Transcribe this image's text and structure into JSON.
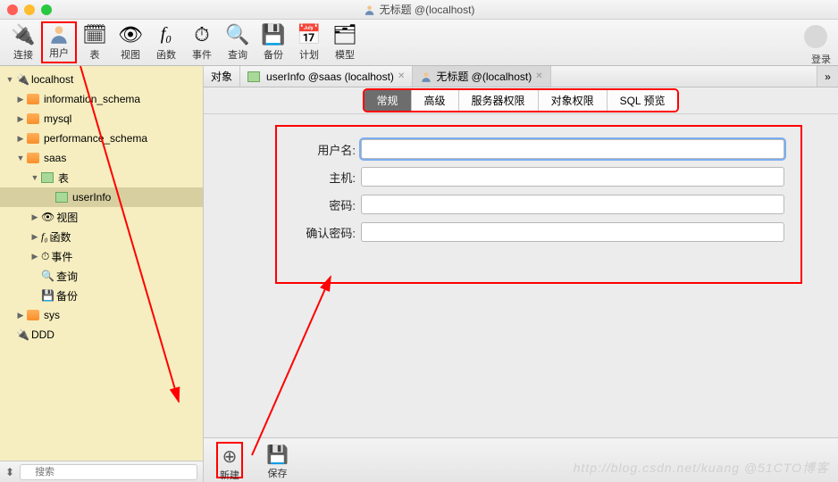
{
  "window": {
    "title": "无标题 @(localhost)"
  },
  "toolbar": {
    "items": [
      "连接",
      "用户",
      "表",
      "视图",
      "函数",
      "事件",
      "查询",
      "备份",
      "计划",
      "模型"
    ],
    "login": "登录"
  },
  "sidebar": {
    "conn": "localhost",
    "dbs": [
      "information_schema",
      "mysql",
      "performance_schema",
      "saas",
      "sys"
    ],
    "saas_children": {
      "table": "表",
      "userinfo": "userInfo",
      "view": "视图",
      "func": "函数",
      "event": "事件",
      "query": "查询",
      "backup": "备份"
    },
    "ddd": "DDD",
    "search_placeholder": "搜索"
  },
  "tabs": {
    "t0": "对象",
    "t1": "userInfo @saas (localhost)",
    "t2": "无标题 @(localhost)"
  },
  "segments": [
    "常规",
    "高级",
    "服务器权限",
    "对象权限",
    "SQL 预览"
  ],
  "form": {
    "username": "用户名:",
    "host": "主机:",
    "password": "密码:",
    "confirm": "确认密码:"
  },
  "bottom": {
    "new": "新建",
    "save": "保存"
  },
  "watermark": "http://blog.csdn.net/kuang   @51CTO博客"
}
